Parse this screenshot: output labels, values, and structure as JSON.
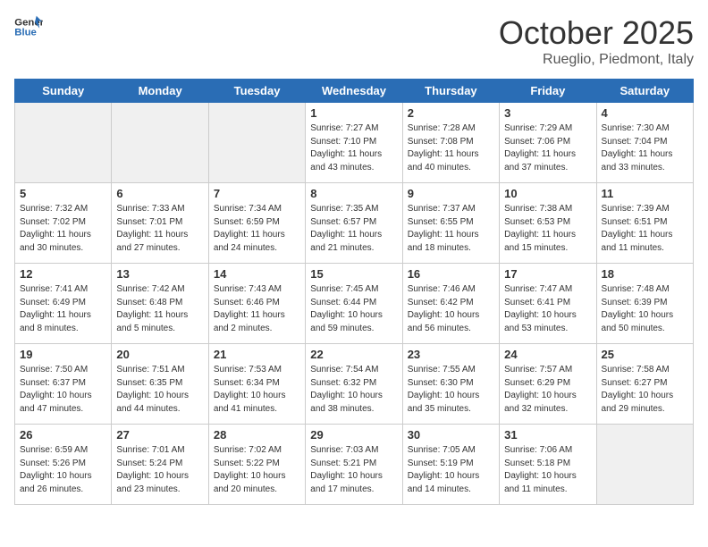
{
  "header": {
    "logo_line1": "General",
    "logo_line2": "Blue",
    "month": "October 2025",
    "location": "Rueglio, Piedmont, Italy"
  },
  "days_of_week": [
    "Sunday",
    "Monday",
    "Tuesday",
    "Wednesday",
    "Thursday",
    "Friday",
    "Saturday"
  ],
  "weeks": [
    [
      {
        "day": "",
        "info": ""
      },
      {
        "day": "",
        "info": ""
      },
      {
        "day": "",
        "info": ""
      },
      {
        "day": "1",
        "info": "Sunrise: 7:27 AM\nSunset: 7:10 PM\nDaylight: 11 hours\nand 43 minutes."
      },
      {
        "day": "2",
        "info": "Sunrise: 7:28 AM\nSunset: 7:08 PM\nDaylight: 11 hours\nand 40 minutes."
      },
      {
        "day": "3",
        "info": "Sunrise: 7:29 AM\nSunset: 7:06 PM\nDaylight: 11 hours\nand 37 minutes."
      },
      {
        "day": "4",
        "info": "Sunrise: 7:30 AM\nSunset: 7:04 PM\nDaylight: 11 hours\nand 33 minutes."
      }
    ],
    [
      {
        "day": "5",
        "info": "Sunrise: 7:32 AM\nSunset: 7:02 PM\nDaylight: 11 hours\nand 30 minutes."
      },
      {
        "day": "6",
        "info": "Sunrise: 7:33 AM\nSunset: 7:01 PM\nDaylight: 11 hours\nand 27 minutes."
      },
      {
        "day": "7",
        "info": "Sunrise: 7:34 AM\nSunset: 6:59 PM\nDaylight: 11 hours\nand 24 minutes."
      },
      {
        "day": "8",
        "info": "Sunrise: 7:35 AM\nSunset: 6:57 PM\nDaylight: 11 hours\nand 21 minutes."
      },
      {
        "day": "9",
        "info": "Sunrise: 7:37 AM\nSunset: 6:55 PM\nDaylight: 11 hours\nand 18 minutes."
      },
      {
        "day": "10",
        "info": "Sunrise: 7:38 AM\nSunset: 6:53 PM\nDaylight: 11 hours\nand 15 minutes."
      },
      {
        "day": "11",
        "info": "Sunrise: 7:39 AM\nSunset: 6:51 PM\nDaylight: 11 hours\nand 11 minutes."
      }
    ],
    [
      {
        "day": "12",
        "info": "Sunrise: 7:41 AM\nSunset: 6:49 PM\nDaylight: 11 hours\nand 8 minutes."
      },
      {
        "day": "13",
        "info": "Sunrise: 7:42 AM\nSunset: 6:48 PM\nDaylight: 11 hours\nand 5 minutes."
      },
      {
        "day": "14",
        "info": "Sunrise: 7:43 AM\nSunset: 6:46 PM\nDaylight: 11 hours\nand 2 minutes."
      },
      {
        "day": "15",
        "info": "Sunrise: 7:45 AM\nSunset: 6:44 PM\nDaylight: 10 hours\nand 59 minutes."
      },
      {
        "day": "16",
        "info": "Sunrise: 7:46 AM\nSunset: 6:42 PM\nDaylight: 10 hours\nand 56 minutes."
      },
      {
        "day": "17",
        "info": "Sunrise: 7:47 AM\nSunset: 6:41 PM\nDaylight: 10 hours\nand 53 minutes."
      },
      {
        "day": "18",
        "info": "Sunrise: 7:48 AM\nSunset: 6:39 PM\nDaylight: 10 hours\nand 50 minutes."
      }
    ],
    [
      {
        "day": "19",
        "info": "Sunrise: 7:50 AM\nSunset: 6:37 PM\nDaylight: 10 hours\nand 47 minutes."
      },
      {
        "day": "20",
        "info": "Sunrise: 7:51 AM\nSunset: 6:35 PM\nDaylight: 10 hours\nand 44 minutes."
      },
      {
        "day": "21",
        "info": "Sunrise: 7:53 AM\nSunset: 6:34 PM\nDaylight: 10 hours\nand 41 minutes."
      },
      {
        "day": "22",
        "info": "Sunrise: 7:54 AM\nSunset: 6:32 PM\nDaylight: 10 hours\nand 38 minutes."
      },
      {
        "day": "23",
        "info": "Sunrise: 7:55 AM\nSunset: 6:30 PM\nDaylight: 10 hours\nand 35 minutes."
      },
      {
        "day": "24",
        "info": "Sunrise: 7:57 AM\nSunset: 6:29 PM\nDaylight: 10 hours\nand 32 minutes."
      },
      {
        "day": "25",
        "info": "Sunrise: 7:58 AM\nSunset: 6:27 PM\nDaylight: 10 hours\nand 29 minutes."
      }
    ],
    [
      {
        "day": "26",
        "info": "Sunrise: 6:59 AM\nSunset: 5:26 PM\nDaylight: 10 hours\nand 26 minutes."
      },
      {
        "day": "27",
        "info": "Sunrise: 7:01 AM\nSunset: 5:24 PM\nDaylight: 10 hours\nand 23 minutes."
      },
      {
        "day": "28",
        "info": "Sunrise: 7:02 AM\nSunset: 5:22 PM\nDaylight: 10 hours\nand 20 minutes."
      },
      {
        "day": "29",
        "info": "Sunrise: 7:03 AM\nSunset: 5:21 PM\nDaylight: 10 hours\nand 17 minutes."
      },
      {
        "day": "30",
        "info": "Sunrise: 7:05 AM\nSunset: 5:19 PM\nDaylight: 10 hours\nand 14 minutes."
      },
      {
        "day": "31",
        "info": "Sunrise: 7:06 AM\nSunset: 5:18 PM\nDaylight: 10 hours\nand 11 minutes."
      },
      {
        "day": "",
        "info": ""
      }
    ]
  ]
}
